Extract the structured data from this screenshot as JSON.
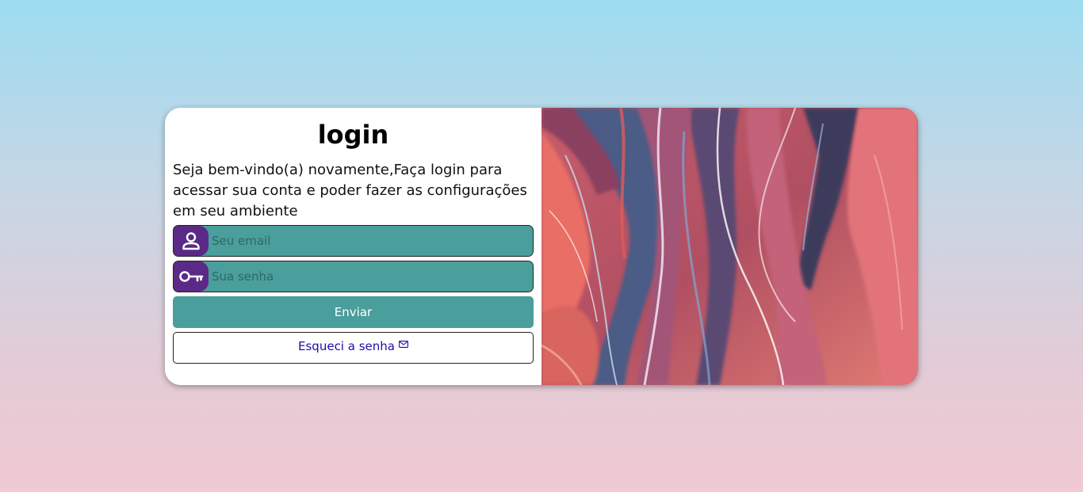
{
  "login": {
    "title": "login",
    "welcome": "Seja bem-vindo(a) novamente,Faça login para acessar sua conta e poder fazer as configurações em seu ambiente",
    "email_placeholder": "Seu email",
    "password_placeholder": "Sua senha",
    "submit_label": "Enviar",
    "forgot_label": "Esqueci a senha"
  },
  "icons": {
    "email": "user-icon",
    "password": "key-icon",
    "forgot": "mail-icon"
  },
  "colors": {
    "accent": "#4a9e9c",
    "icon_bg": "#5b2a86",
    "link": "#1a0dab"
  }
}
